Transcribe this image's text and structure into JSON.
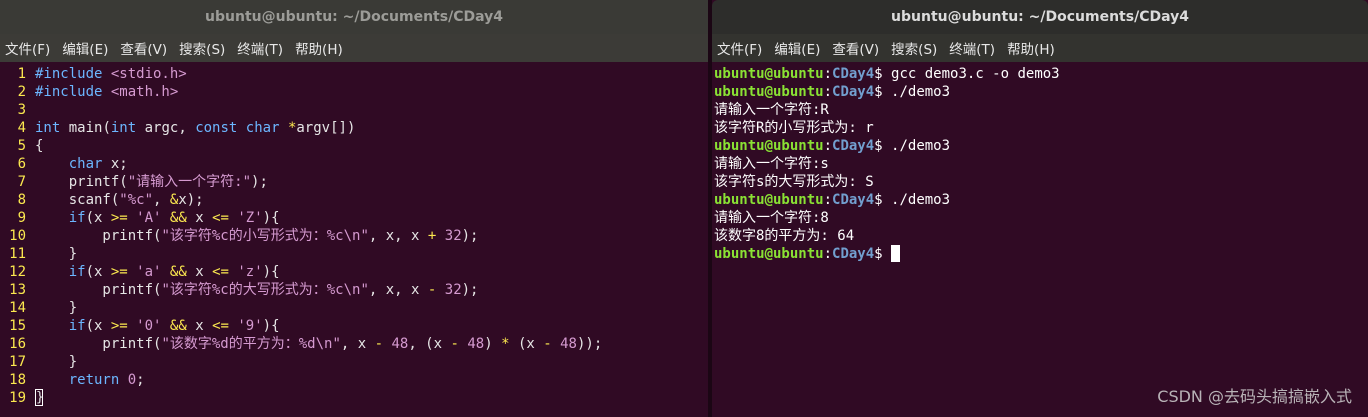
{
  "left_window": {
    "title": "ubuntu@ubuntu: ~/Documents/CDay4",
    "menu": [
      "文件(F)",
      "编辑(E)",
      "查看(V)",
      "搜索(S)",
      "终端(T)",
      "帮助(H)"
    ],
    "code_lines": [
      {
        "n": "1",
        "segments": [
          [
            "pp",
            "#include "
          ],
          [
            "inc",
            "<stdio.h>"
          ]
        ]
      },
      {
        "n": "2",
        "segments": [
          [
            "pp",
            "#include "
          ],
          [
            "inc",
            "<math.h>"
          ]
        ]
      },
      {
        "n": "3",
        "segments": []
      },
      {
        "n": "4",
        "segments": [
          [
            "ty",
            "int"
          ],
          [
            "code",
            " main("
          ],
          [
            "ty",
            "int"
          ],
          [
            "code",
            " argc, "
          ],
          [
            "ty",
            "const"
          ],
          [
            "code",
            " "
          ],
          [
            "ty",
            "char"
          ],
          [
            "code",
            " "
          ],
          [
            "op",
            "*"
          ],
          [
            "code",
            "argv[])"
          ]
        ]
      },
      {
        "n": "5",
        "segments": [
          [
            "code",
            "{"
          ]
        ]
      },
      {
        "n": "6",
        "segments": [
          [
            "code",
            "    "
          ],
          [
            "ty",
            "char"
          ],
          [
            "code",
            " x;"
          ]
        ]
      },
      {
        "n": "7",
        "segments": [
          [
            "code",
            "    printf("
          ],
          [
            "str",
            "\"请输入一个字符:\""
          ],
          [
            "code",
            ");"
          ]
        ]
      },
      {
        "n": "8",
        "segments": [
          [
            "code",
            "    scanf("
          ],
          [
            "str",
            "\"%c\""
          ],
          [
            "code",
            ", "
          ],
          [
            "op",
            "&"
          ],
          [
            "code",
            "x);"
          ]
        ]
      },
      {
        "n": "9",
        "segments": [
          [
            "code",
            "    "
          ],
          [
            "kw",
            "if"
          ],
          [
            "code",
            "(x "
          ],
          [
            "op",
            ">="
          ],
          [
            "code",
            " "
          ],
          [
            "str",
            "'A'"
          ],
          [
            "code",
            " "
          ],
          [
            "op",
            "&&"
          ],
          [
            "code",
            " x "
          ],
          [
            "op",
            "<="
          ],
          [
            "code",
            " "
          ],
          [
            "str",
            "'Z'"
          ],
          [
            "code",
            "){"
          ]
        ]
      },
      {
        "n": "10",
        "segments": [
          [
            "code",
            "        printf("
          ],
          [
            "str",
            "\"该字符%c的小写形式为：%c\\n\""
          ],
          [
            "code",
            ", x, x "
          ],
          [
            "op",
            "+"
          ],
          [
            "code",
            " "
          ],
          [
            "num",
            "32"
          ],
          [
            "code",
            ");"
          ]
        ]
      },
      {
        "n": "11",
        "segments": [
          [
            "code",
            "    }"
          ]
        ]
      },
      {
        "n": "12",
        "segments": [
          [
            "code",
            "    "
          ],
          [
            "kw",
            "if"
          ],
          [
            "code",
            "(x "
          ],
          [
            "op",
            ">="
          ],
          [
            "code",
            " "
          ],
          [
            "str",
            "'a'"
          ],
          [
            "code",
            " "
          ],
          [
            "op",
            "&&"
          ],
          [
            "code",
            " x "
          ],
          [
            "op",
            "<="
          ],
          [
            "code",
            " "
          ],
          [
            "str",
            "'z'"
          ],
          [
            "code",
            "){"
          ]
        ]
      },
      {
        "n": "13",
        "segments": [
          [
            "code",
            "        printf("
          ],
          [
            "str",
            "\"该字符%c的大写形式为：%c\\n\""
          ],
          [
            "code",
            ", x, x "
          ],
          [
            "op",
            "-"
          ],
          [
            "code",
            " "
          ],
          [
            "num",
            "32"
          ],
          [
            "code",
            ");"
          ]
        ]
      },
      {
        "n": "14",
        "segments": [
          [
            "code",
            "    }"
          ]
        ]
      },
      {
        "n": "15",
        "segments": [
          [
            "code",
            "    "
          ],
          [
            "kw",
            "if"
          ],
          [
            "code",
            "(x "
          ],
          [
            "op",
            ">="
          ],
          [
            "code",
            " "
          ],
          [
            "str",
            "'0'"
          ],
          [
            "code",
            " "
          ],
          [
            "op",
            "&&"
          ],
          [
            "code",
            " x "
          ],
          [
            "op",
            "<="
          ],
          [
            "code",
            " "
          ],
          [
            "str",
            "'9'"
          ],
          [
            "code",
            "){"
          ]
        ]
      },
      {
        "n": "16",
        "segments": [
          [
            "code",
            "        printf("
          ],
          [
            "str",
            "\"该数字%d的平方为：%d\\n\""
          ],
          [
            "code",
            ", x "
          ],
          [
            "op",
            "-"
          ],
          [
            "code",
            " "
          ],
          [
            "num",
            "48"
          ],
          [
            "code",
            ", (x "
          ],
          [
            "op",
            "-"
          ],
          [
            "code",
            " "
          ],
          [
            "num",
            "48"
          ],
          [
            "code",
            ") "
          ],
          [
            "op",
            "*"
          ],
          [
            "code",
            " (x "
          ],
          [
            "op",
            "-"
          ],
          [
            "code",
            " "
          ],
          [
            "num",
            "48"
          ],
          [
            "code",
            "));"
          ]
        ]
      },
      {
        "n": "17",
        "segments": [
          [
            "code",
            "    }"
          ]
        ]
      },
      {
        "n": "18",
        "segments": [
          [
            "code",
            "    "
          ],
          [
            "kw",
            "return"
          ],
          [
            "code",
            " "
          ],
          [
            "num",
            "0"
          ],
          [
            "code",
            ";"
          ]
        ]
      },
      {
        "n": "19",
        "segments": [
          [
            "cursor",
            "}"
          ]
        ]
      }
    ]
  },
  "right_window": {
    "title": "ubuntu@ubuntu: ~/Documents/CDay4",
    "menu": [
      "文件(F)",
      "编辑(E)",
      "查看(V)",
      "搜索(S)",
      "终端(T)",
      "帮助(H)"
    ],
    "prompt_user": "ubuntu@ubuntu",
    "prompt_path": "CDay4",
    "lines": [
      {
        "type": "prompt",
        "cmd": "gcc demo3.c -o demo3"
      },
      {
        "type": "prompt",
        "cmd": "./demo3"
      },
      {
        "type": "out",
        "text": "请输入一个字符:R"
      },
      {
        "type": "out",
        "text": "该字符R的小写形式为: r"
      },
      {
        "type": "prompt",
        "cmd": "./demo3"
      },
      {
        "type": "out",
        "text": "请输入一个字符:s"
      },
      {
        "type": "out",
        "text": "该字符s的大写形式为: S"
      },
      {
        "type": "prompt",
        "cmd": "./demo3"
      },
      {
        "type": "out",
        "text": "请输入一个字符:8"
      },
      {
        "type": "out",
        "text": "该数字8的平方为: 64"
      },
      {
        "type": "prompt",
        "cmd": "",
        "cursor": true
      }
    ]
  },
  "watermark": "CSDN @去码头搞搞嵌入式"
}
